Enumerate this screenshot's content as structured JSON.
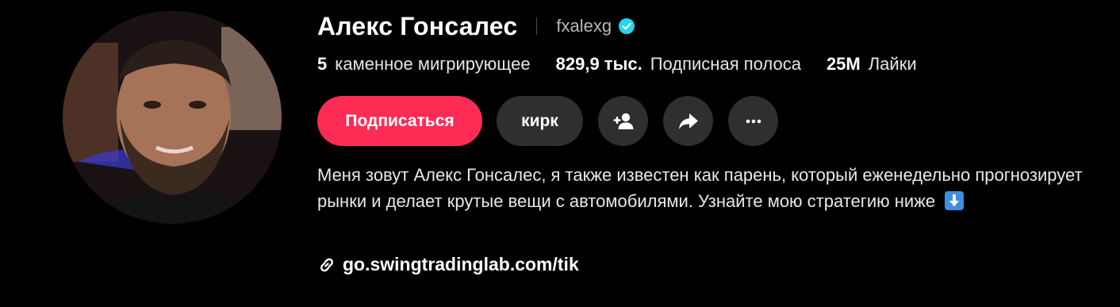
{
  "profile": {
    "display_name": "Алекс Гонсалес",
    "username": "fxalexg",
    "verified": true
  },
  "stats": [
    {
      "value": "5",
      "label": "каменное мигрирующее"
    },
    {
      "value": "829,9 тыс.",
      "label": "Подписная полоса"
    },
    {
      "value": "25M",
      "label": "Лайки"
    }
  ],
  "actions": {
    "subscribe_label": "Подписаться",
    "secondary_label": "кирк",
    "add_friend_icon": "add-user-icon",
    "share_icon": "share-icon",
    "more_icon": "more-icon"
  },
  "bio": {
    "text": "Меня зовут Алекс Гонсалес, я также известен как парень, который еженедельно прогнозирует рынки и делает крутые вещи с автомобилями. Узнайте мою стратегию ниже",
    "emoji": "down-arrow-emoji"
  },
  "link": {
    "text": "go.swingtradinglab.com/tik",
    "icon": "link-icon"
  },
  "colors": {
    "accent": "#fe2c55",
    "verified": "#20d5ec",
    "button_bg": "#2f2f2f",
    "background": "#000000"
  }
}
